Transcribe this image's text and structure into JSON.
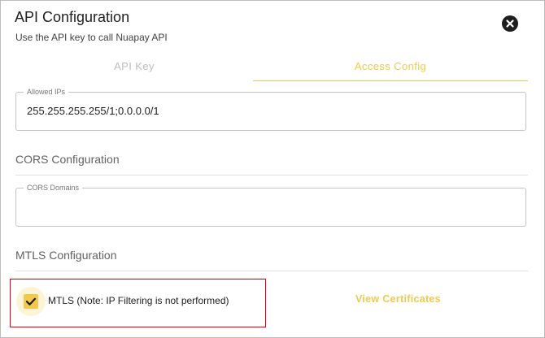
{
  "dialog": {
    "title": "API Configuration",
    "subtitle": "Use the API key to call Nuapay API",
    "close_icon": "close-circle-icon"
  },
  "tabs": [
    {
      "label": "API Key",
      "active": false
    },
    {
      "label": "Access Config",
      "active": true
    }
  ],
  "allowed_ips": {
    "label": "Allowed IPs",
    "value": "255.255.255.255/1;0.0.0.0/1"
  },
  "cors": {
    "section_title": "CORS Configuration",
    "domains_label": "CORS Domains",
    "domains_value": ""
  },
  "mtls": {
    "section_title": "MTLS Configuration",
    "checkbox_label": "MTLS (Note: IP Filtering is not performed)",
    "checked": true,
    "view_certificates_label": "View Certificates"
  },
  "colors": {
    "accent": "#f2c94c",
    "highlight_border": "#d50000"
  }
}
